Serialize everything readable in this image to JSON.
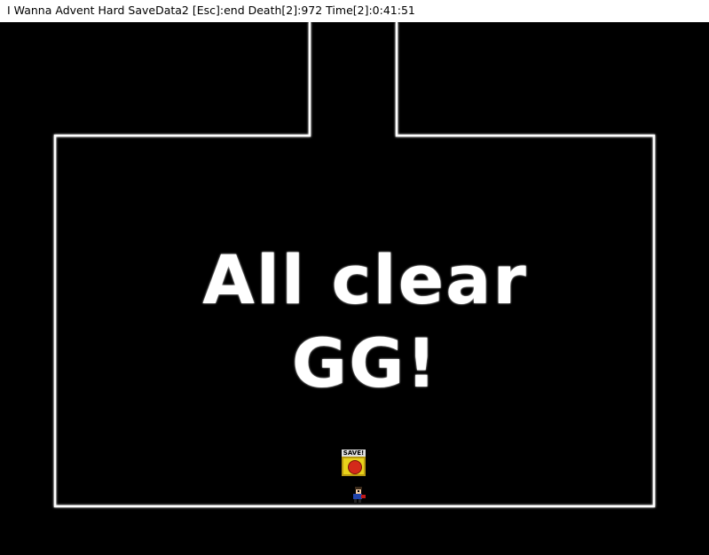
{
  "window": {
    "title": "I Wanna Advent Hard  SaveData2   [Esc]:end Death[2]:972 Time[2]:0:41:51"
  },
  "game": {
    "message_line1": "All clear",
    "message_line2": "GG!",
    "save_label": "SAVE!",
    "colors": {
      "background": "#000000",
      "wall_outline": "#ffffff",
      "save_box": "#e8d21a",
      "save_orb": "#d42a1a"
    }
  }
}
